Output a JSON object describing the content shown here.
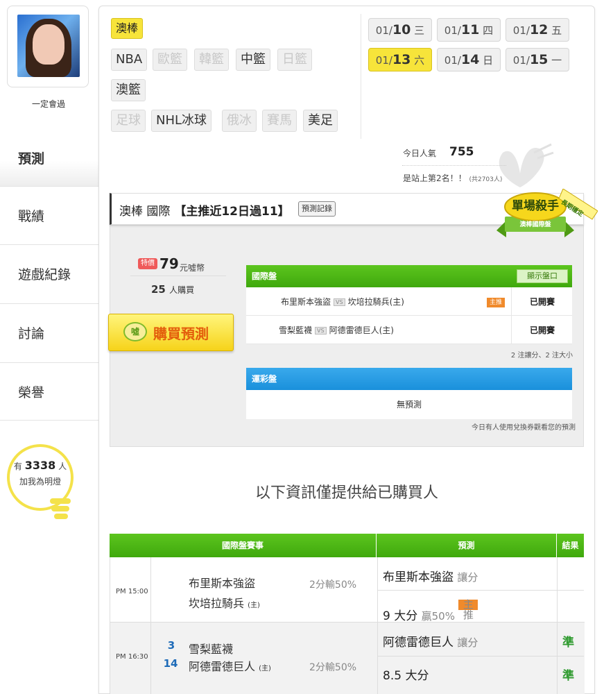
{
  "profile": {
    "username": "一定會過"
  },
  "sidebar": {
    "items": [
      {
        "label": "預測"
      },
      {
        "label": "戰績"
      },
      {
        "label": "遊戲紀錄"
      },
      {
        "label": "討論"
      },
      {
        "label": "榮譽"
      }
    ],
    "fans": {
      "prefix": "有",
      "count": "3338",
      "suffix": "人",
      "cta": "加我為明燈"
    }
  },
  "categories": {
    "selected": "澳棒",
    "row2": [
      "NBA",
      "歐籃",
      "韓籃",
      "中籃",
      "日籃"
    ],
    "row3": [
      "澳籃"
    ],
    "row4": [
      "足球",
      "NHL冰球",
      "俄冰",
      "賽馬",
      "美足"
    ]
  },
  "dates": [
    {
      "md": "01/",
      "day": "10",
      "wd": "三"
    },
    {
      "md": "01/",
      "day": "11",
      "wd": "四"
    },
    {
      "md": "01/",
      "day": "12",
      "wd": "五"
    },
    {
      "md": "01/",
      "day": "13",
      "wd": "六"
    },
    {
      "md": "01/",
      "day": "14",
      "wd": "日"
    },
    {
      "md": "01/",
      "day": "15",
      "wd": "一"
    }
  ],
  "stats": {
    "popularity_label": "今日人氣",
    "popularity_value": "755",
    "rank_text": "是站上第2名！！",
    "rank_total": "(共2703人)"
  },
  "recommendation": {
    "title_league": "澳棒 國際",
    "title_streak": "【主推近12日過11】",
    "record_btn": "預測記錄",
    "badge_title": "單場殺手",
    "badge_sub": "澳棒國際盤",
    "badge_ribbon": "長期穩定",
    "price_tag": "特價",
    "price": "79",
    "price_unit": "元噓幣",
    "buyers_count": "25",
    "buyers_label": "人購買",
    "buy_icon": "噓",
    "buy_button": "購買預測",
    "intl_header": "國際盤",
    "show_odds_btn": "顯示盤口",
    "games": [
      {
        "away": "布里斯本強盜",
        "vs": "VS",
        "home": "坎培拉騎兵(主)",
        "tag": "主推",
        "status": "已開賽"
      },
      {
        "away": "雪梨藍襪",
        "vs": "VS",
        "home": "阿德雷德巨人(主)",
        "tag": "",
        "status": "已開賽"
      }
    ],
    "intl_note": "2 注讓分、2 注大小",
    "lottery_header": "運彩盤",
    "lottery_body": "無預測",
    "lottery_note": "今日有人使用兌換券觀看您的預測"
  },
  "info_note": "以下資訊僅提供給已購買人",
  "results": {
    "headers": {
      "match": "國際盤賽事",
      "pred": "預測",
      "result": "結果"
    },
    "matches": [
      {
        "time": "PM 15:00",
        "score_away": "",
        "score_home": "",
        "away": "布里斯本強盜",
        "home": "坎培拉騎兵",
        "home_mark": "(主)",
        "line": "2分輸50%",
        "picks": [
          {
            "main": "布里斯本強盜",
            "sub": "讓分",
            "tag": "",
            "result": ""
          },
          {
            "main": "9 大分",
            "sub": "贏50%",
            "tag": "主推",
            "result": ""
          }
        ]
      },
      {
        "time": "PM 16:30",
        "score_away": "3",
        "score_home": "14",
        "away": "雪梨藍襪",
        "home": "阿德雷德巨人",
        "home_mark": "(主)",
        "line": "2分輸50%",
        "picks": [
          {
            "main": "阿德雷德巨人",
            "sub": "讓分",
            "tag": "",
            "result": "準"
          },
          {
            "main": "8.5 大分",
            "sub": "",
            "tag": "",
            "result": "準"
          }
        ]
      }
    ]
  },
  "colors": {
    "accent_yellow": "#f7e43a",
    "green": "#3fa80d",
    "blue": "#1a90db",
    "orange": "#f08a2b"
  }
}
